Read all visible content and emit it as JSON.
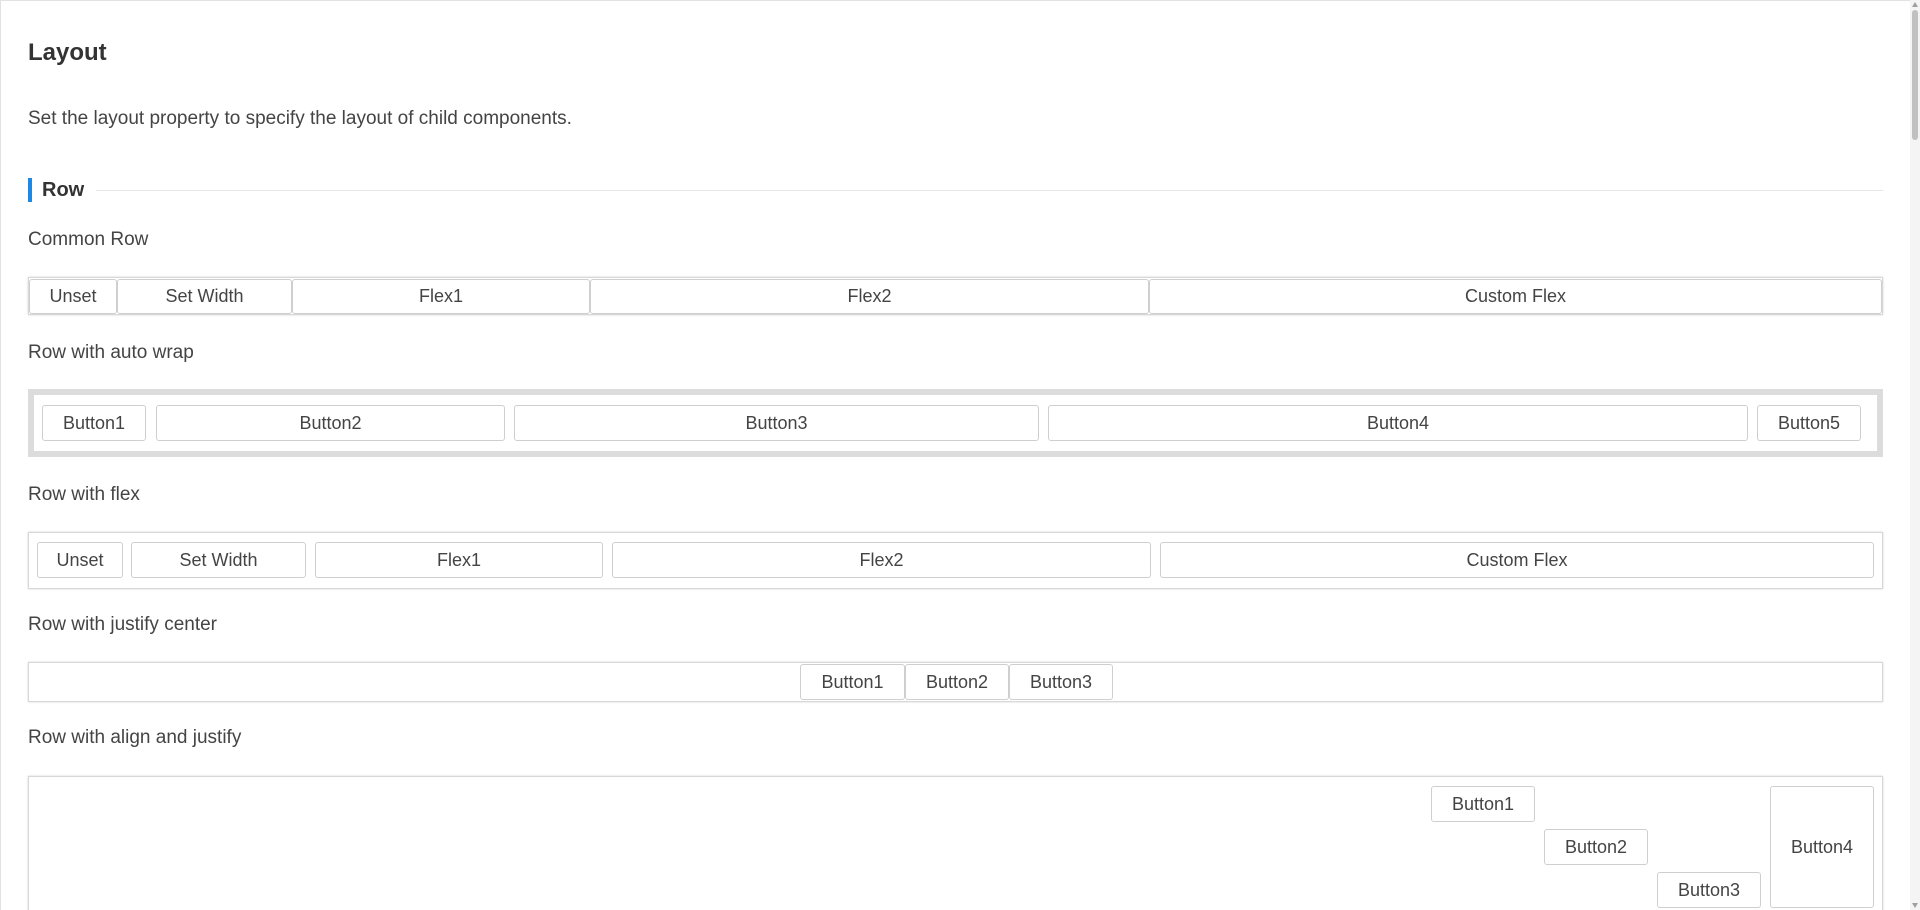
{
  "page": {
    "title": "Layout",
    "description": "Set the layout property to specify the layout of child components."
  },
  "section": {
    "title": "Row",
    "accent_color": "#1e88e5"
  },
  "examples": {
    "common_row": {
      "label": "Common Row",
      "buttons": [
        "Unset",
        "Set Width",
        "Flex1",
        "Flex2",
        "Custom Flex"
      ]
    },
    "auto_wrap": {
      "label": "Row with auto wrap",
      "buttons": [
        "Button1",
        "Button2",
        "Button3",
        "Button4",
        "Button5"
      ]
    },
    "flex": {
      "label": "Row with flex",
      "buttons": [
        "Unset",
        "Set Width",
        "Flex1",
        "Flex2",
        "Custom Flex"
      ]
    },
    "justify_center": {
      "label": "Row with justify center",
      "buttons": [
        "Button1",
        "Button2",
        "Button3"
      ]
    },
    "align_justify": {
      "label": "Row with align and justify",
      "buttons": [
        "Button1",
        "Button2",
        "Button3",
        "Button4"
      ]
    }
  }
}
